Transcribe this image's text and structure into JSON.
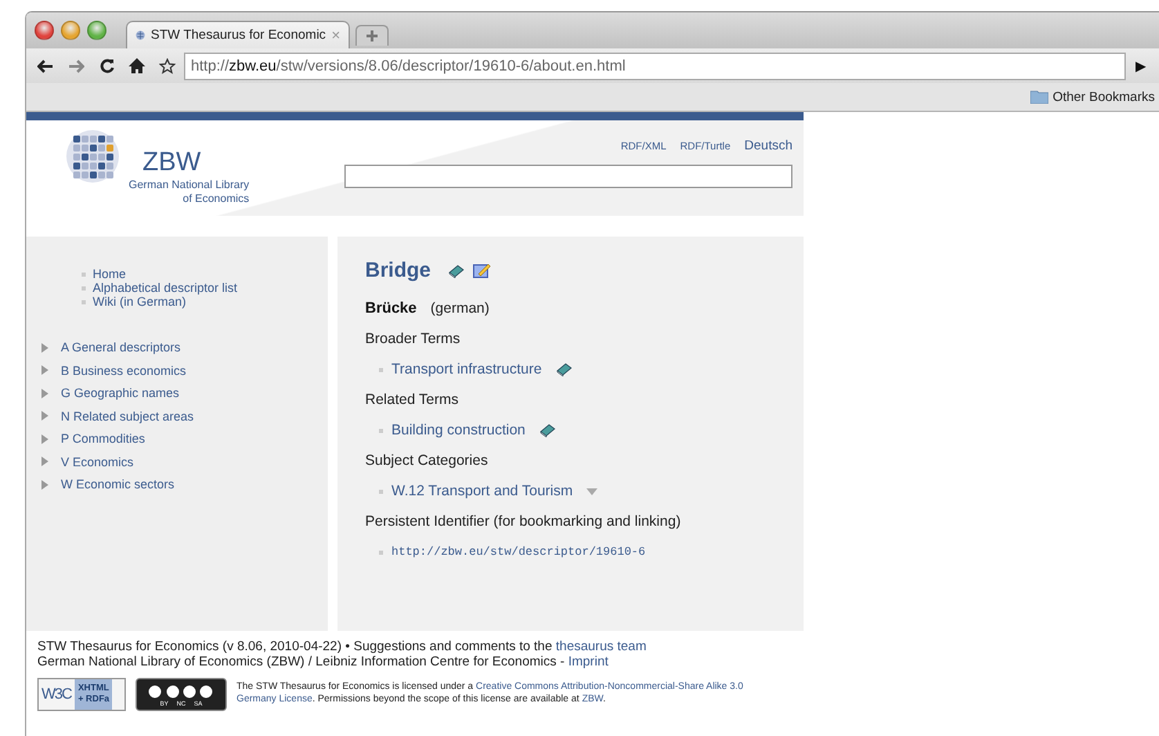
{
  "browser": {
    "tab_title": "STW Thesaurus for Economic",
    "tab_close": "×",
    "url": "http://**zbw.eu**/stw/versions/8.06/descriptor/19610-6/about.en.html",
    "go": "▶",
    "bookmark": "Other Bookmarks"
  },
  "header": {
    "logo": "ZBW",
    "subtitle": [
      "German National Library",
      "of Economics"
    ],
    "links": [
      {
        "text": "RDF/XML",
        "kind": "small"
      },
      {
        "text": "RDF/Turtle",
        "kind": "small"
      },
      {
        "text": "Deutsch",
        "kind": "large"
      }
    ]
  },
  "nav": [
    "Home",
    "Alphabetical descriptor list",
    "Wiki (in German)"
  ],
  "tree": [
    {
      "label": "A General descriptors",
      "expanded": false
    },
    {
      "label": "B Business economics",
      "expanded": false
    },
    {
      "label": "G Geographic names",
      "expanded": false
    },
    {
      "label": "N Related subject areas",
      "expanded": false
    },
    {
      "label": "P Commodities",
      "expanded": false
    },
    {
      "label": "V Economics",
      "expanded": false
    },
    {
      "label": "W Economic sectors",
      "expanded": false
    }
  ],
  "descriptor": {
    "title": "Bridge",
    "alt_label": "Brücke",
    "alt_lang": "(german)",
    "sections": [
      {
        "heading": "Broader Terms",
        "items": [
          {
            "text": "Transport infrastructure",
            "kind": "concept"
          }
        ]
      },
      {
        "heading": "Related Terms",
        "items": [
          {
            "text": "Building construction",
            "kind": "concept"
          }
        ]
      },
      {
        "heading": "Subject Categories",
        "items": [
          {
            "text": "W.12 Transport and Tourism",
            "kind": "category"
          }
        ]
      },
      {
        "heading": "Persistent Identifier (for bookmarking and linking)",
        "items": [
          {
            "text": "http://zbw.eu/stw/descriptor/19610-6",
            "kind": "uri"
          }
        ]
      }
    ]
  },
  "footer": {
    "lines": [
      [
        {
          "text": "STW Thesaurus for Economics (v 8.06, 2010-04-22)  •  Suggestions and comments to the ",
          "kind": "text"
        },
        {
          "text": "thesaurus team",
          "kind": "link"
        }
      ],
      [
        {
          "text": "German National Library of Economics (ZBW) / Leibniz Information Centre for Economics - ",
          "kind": "text"
        },
        {
          "text": "Imprint",
          "kind": "link"
        }
      ]
    ],
    "badges": {
      "w3c": "W3C",
      "xhtml": "XHTML",
      "rdfa": "+ RDFa",
      "cc": [
        "BY",
        "NC",
        "SA"
      ]
    },
    "license": [
      [
        {
          "text": "The STW Thesaurus for Economics is licensed under a ",
          "kind": "text"
        },
        {
          "text": "Creative Commons Attribution-Noncommercial-Share Alike 3.0",
          "kind": "link"
        }
      ],
      [
        {
          "text": "Germany License",
          "kind": "link"
        },
        {
          "text": ". Permissions beyond the scope of this license are available at ",
          "kind": "text"
        },
        {
          "text": "ZBW",
          "kind": "link"
        },
        {
          "text": ".",
          "kind": "text"
        }
      ]
    ]
  }
}
